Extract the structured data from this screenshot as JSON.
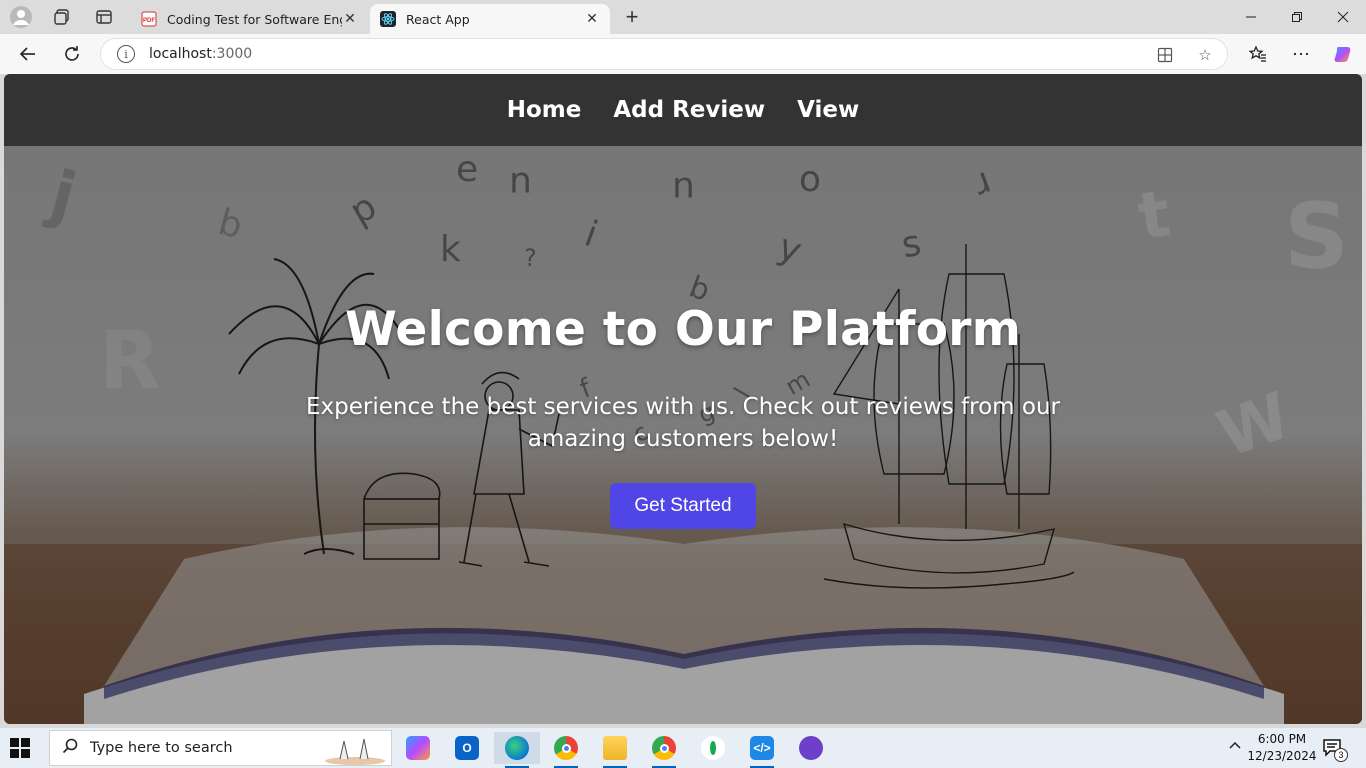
{
  "browser": {
    "tabs": [
      {
        "title": "Coding Test for Software Engineer",
        "favicon": "pdf-icon"
      },
      {
        "title": "React App",
        "favicon": "react-icon"
      }
    ],
    "url_host": "localhost",
    "url_port": ":3000"
  },
  "page": {
    "nav": {
      "home": "Home",
      "add_review": "Add Review",
      "view": "View"
    },
    "hero": {
      "title": "Welcome to Our Platform",
      "subtitle": "Experience the best services with us. Check out reviews from our amazing customers below!",
      "cta": "Get Started"
    },
    "accent_color": "#4f46e5",
    "floating_letters": [
      "p",
      "e",
      "u",
      "u",
      "o",
      "r",
      "k",
      "?",
      "i",
      "y",
      "s",
      "b",
      "q",
      "a",
      "f",
      "c",
      "g",
      "l",
      "m",
      "j",
      "t",
      "S",
      "W",
      "R"
    ]
  },
  "taskbar": {
    "search_placeholder": "Type here to search",
    "time": "6:00 PM",
    "date": "12/23/2024",
    "notification_count": "3"
  }
}
